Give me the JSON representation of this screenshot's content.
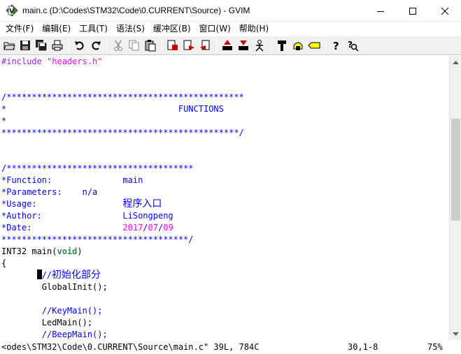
{
  "window": {
    "title": "main.c (D:\\Codes\\STM32\\Code\\0.CURRENT\\Source) - GVIM",
    "app_icon": "gvim-icon",
    "controls": [
      "minimize-icon",
      "maximize-icon",
      "close-icon"
    ]
  },
  "menu": {
    "items": [
      {
        "label": "文件(F)"
      },
      {
        "label": "编辑(E)"
      },
      {
        "label": "工具(T)"
      },
      {
        "label": "语法(S)"
      },
      {
        "label": "缓冲区(B)"
      },
      {
        "label": "窗口(W)"
      },
      {
        "label": "帮助(H)"
      }
    ]
  },
  "toolbar": {
    "icons": [
      "open-icon",
      "save-icon",
      "save-all-icon",
      "print-icon",
      "undo-icon",
      "redo-icon",
      "cut-icon",
      "copy-icon",
      "paste-icon",
      "find-replace-icon",
      "find-next-icon",
      "find-prev-icon",
      "load-session-icon",
      "save-session-icon",
      "run-script-icon",
      "make-icon",
      "shell-icon",
      "tags-icon",
      "help-icon",
      "find-help-icon"
    ]
  },
  "editor": {
    "lines": [
      [
        {
          "t": "#include ",
          "c": "c-pre"
        },
        {
          "t": "\"headers.h\"",
          "c": "c-str"
        }
      ],
      [],
      [],
      [
        {
          "t": "/***********************************************",
          "c": "c-com"
        }
      ],
      [
        {
          "t": "*                                  FUNCTIONS",
          "c": "c-com"
        }
      ],
      [
        {
          "t": "*",
          "c": "c-com"
        }
      ],
      [
        {
          "t": "***********************************************/",
          "c": "c-com"
        }
      ],
      [],
      [],
      [
        {
          "t": "/*************************************",
          "c": "c-com"
        }
      ],
      [
        {
          "t": "*Function:              main",
          "c": "c-com"
        }
      ],
      [
        {
          "t": "*Parameters:    n/a",
          "c": "c-com"
        }
      ],
      [
        {
          "t": "*Usage:                 ",
          "c": "c-com"
        },
        {
          "t": "程序入口",
          "c": "c-com cjk"
        }
      ],
      [
        {
          "t": "*Author:                LiSongpeng",
          "c": "c-com"
        }
      ],
      [
        {
          "t": "*Date:                  ",
          "c": "c-com"
        },
        {
          "t": "2017",
          "c": "c-num"
        },
        {
          "t": "/",
          "c": "c-com"
        },
        {
          "t": "07",
          "c": "c-num"
        },
        {
          "t": "/",
          "c": "c-com"
        },
        {
          "t": "09",
          "c": "c-num"
        }
      ],
      [
        {
          "t": "*************************************/",
          "c": "c-com"
        }
      ],
      [
        {
          "t": "INT32 main(",
          "c": ""
        },
        {
          "t": "void",
          "c": "c-type"
        },
        {
          "t": ")",
          "c": ""
        }
      ],
      [
        {
          "t": "{",
          "c": ""
        }
      ],
      [
        {
          "t": "       ",
          "c": ""
        },
        {
          "t": "",
          "c": "cursor"
        },
        {
          "t": "//",
          "c": "c-com"
        },
        {
          "t": "初始化部分",
          "c": "c-com cjk"
        }
      ],
      [
        {
          "t": "        GlobalInit();",
          "c": ""
        }
      ],
      [],
      [
        {
          "t": "        //KeyMain();",
          "c": "c-com"
        }
      ],
      [
        {
          "t": "        LedMain();",
          "c": ""
        }
      ],
      [
        {
          "t": "        //BeepMain();",
          "c": "c-com"
        }
      ]
    ]
  },
  "status": {
    "file": "<odes\\STM32\\Code\\0.CURRENT\\Source\\main.c\" 39L, 784C",
    "position": "30,1-8",
    "percent": "75%"
  },
  "scroll_position": 0.75
}
